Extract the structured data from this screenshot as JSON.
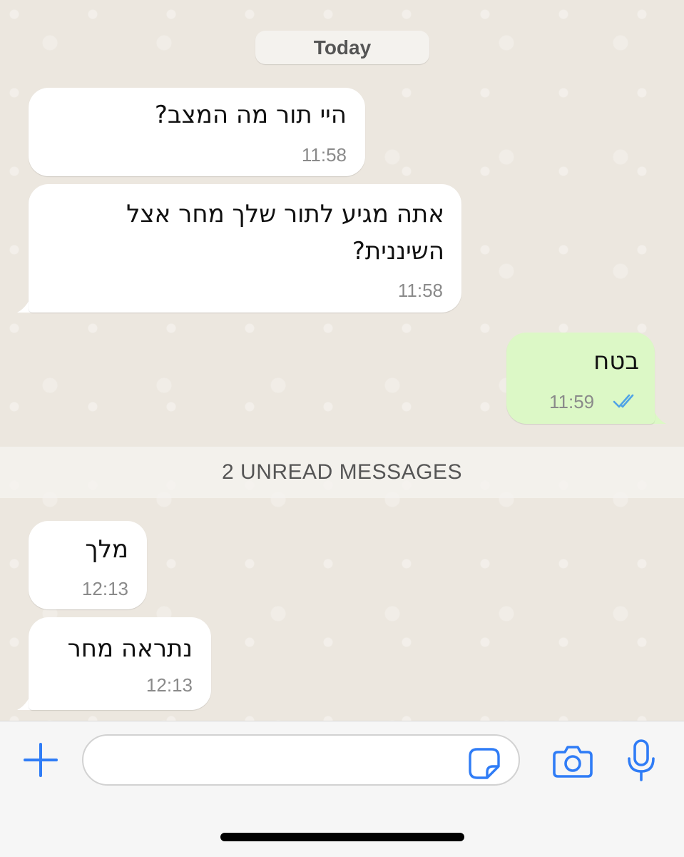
{
  "chat": {
    "date_label": "Today",
    "messages": [
      {
        "text": "היי תור מה המצב?",
        "time": "11:58",
        "direction": "incoming"
      },
      {
        "text": "אתה מגיע לתור שלך מחר אצל\nהשיננית?",
        "time": "11:58",
        "direction": "incoming"
      },
      {
        "text": "בטח",
        "time": "11:59",
        "direction": "outgoing",
        "status": "read"
      },
      {
        "text": "מלך",
        "time": "12:13",
        "direction": "incoming"
      },
      {
        "text": "נתראה מחר",
        "time": "12:13",
        "direction": "incoming"
      }
    ],
    "unread_label": "2 UNREAD MESSAGES"
  },
  "composer": {
    "input_value": "",
    "icons": [
      "plus-icon",
      "sticker-icon",
      "camera-icon",
      "microphone-icon"
    ]
  },
  "colors": {
    "chat_background": "#ece7df",
    "incoming_bubble": "#ffffff",
    "outgoing_bubble": "#dcf8c6",
    "accent_blue": "#2f7cf6",
    "read_ticks": "#4fa3e6"
  }
}
